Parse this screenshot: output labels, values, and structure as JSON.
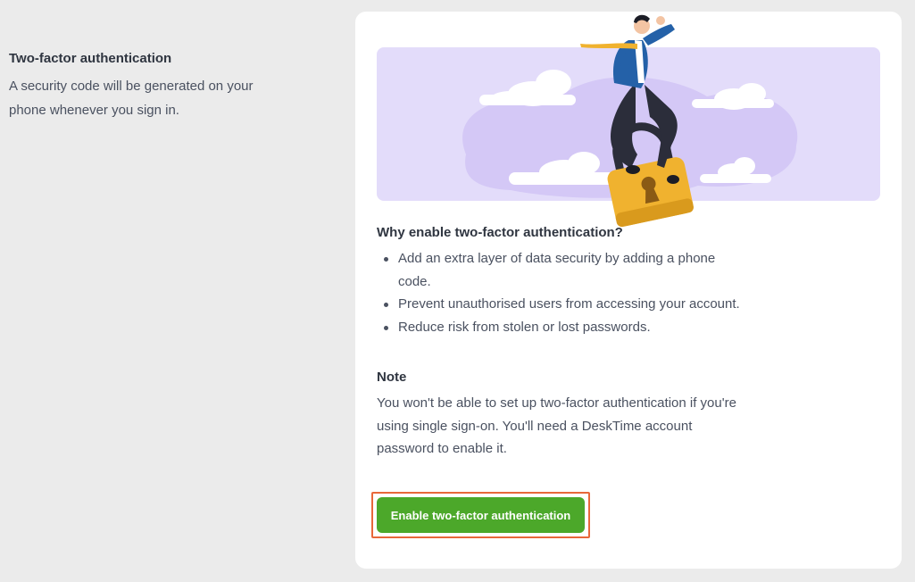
{
  "left": {
    "title": "Two-factor authentication",
    "description": "A security code will be generated on your phone whenever you sign in."
  },
  "card": {
    "why_title": "Why enable two-factor authentication?",
    "reasons": [
      "Add an extra layer of data security by adding a phone code.",
      "Prevent unauthorised users from accessing your account.",
      "Reduce risk from stolen or lost passwords."
    ],
    "note_title": "Note",
    "note_text": "You won't be able to set up two-factor authentication if you're using single sign-on. You'll need a DeskTime account password to enable it.",
    "enable_button": "Enable two-factor authentication"
  },
  "colors": {
    "page_bg": "#ebebeb",
    "card_bg": "#ffffff",
    "hero_bg": "#e3dcfa",
    "button_green": "#4ca82a",
    "highlight_orange": "#e8683a",
    "lock_yellow": "#f0b22f"
  },
  "icons": {
    "hero_illustration": "man-sitting-on-padlock-illustration"
  }
}
